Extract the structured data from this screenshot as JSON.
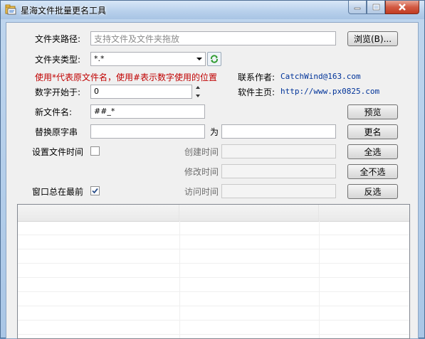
{
  "window": {
    "title": "星海文件批量更名工具"
  },
  "form": {
    "folder_path_label": "文件夹路径:",
    "folder_path_placeholder": "支持文件及文件夹拖放",
    "browse_button": "浏览(B)...",
    "folder_type_label": "文件夹类型:",
    "folder_type_value": "*.*",
    "hint_text": "使用*代表原文件名，使用#表示数字使用的位置",
    "contact_label": "联系作者:",
    "contact_value": "CatchWind@163.com",
    "start_number_label": "数字开始于:",
    "start_number_value": "0",
    "homepage_label": "软件主页:",
    "homepage_value": "http://www.px0825.com",
    "new_name_label": "新文件名:",
    "new_name_value": "##_*",
    "preview_button": "预览",
    "replace_label": "替换原字串",
    "replace_with_label": "为",
    "rename_button": "更名",
    "set_time_label": "设置文件时间",
    "set_time_checked": false,
    "created_time_label": "创建时间",
    "select_all_button": "全选",
    "modified_time_label": "修改时间",
    "select_none_button": "全不选",
    "always_on_top_label": "窗口总在最前",
    "always_on_top_checked": true,
    "accessed_time_label": "访问时间",
    "invert_selection_button": "反选"
  },
  "file_list": {
    "columns": [
      "",
      "",
      ""
    ],
    "rows": []
  },
  "colors": {
    "accent": "#c00000",
    "link": "#003399",
    "title_bar": "#b9d1ec"
  },
  "icons": {
    "app": "folder-edit-icon",
    "refresh": "refresh-icon",
    "minimize": "minimize-icon",
    "maximize": "maximize-icon",
    "close": "close-icon"
  }
}
